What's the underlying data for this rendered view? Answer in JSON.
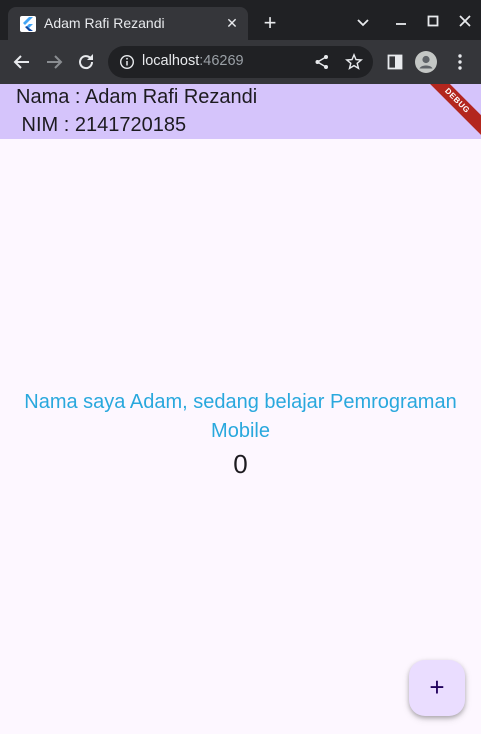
{
  "browser": {
    "tab": {
      "title": "Adam Rafi Rezandi",
      "close_glyph": "✕"
    },
    "new_tab_glyph": "+",
    "url": {
      "host": "localhost",
      "port": ":46269"
    },
    "icons": {
      "favicon": "flutter-logo-icon",
      "info": "info-icon",
      "share": "share-icon",
      "star": "bookmark-star-icon",
      "side_panel": "side-panel-icon",
      "profile": "profile-icon",
      "menu": "kebab-menu-icon",
      "back": "back-arrow-icon",
      "forward": "forward-arrow-icon",
      "reload": "reload-icon",
      "tab_search": "chevron-down-icon",
      "minimize": "minimize-icon",
      "maximize": "maximize-icon",
      "close": "close-icon"
    }
  },
  "app": {
    "appbar": {
      "line1": "Nama : Adam Rafi Rezandi",
      "line2": " NIM : 2141720185"
    },
    "debug_banner": "DEBUG",
    "body_text": "Nama saya Adam, sedang belajar Pemrograman Mobile",
    "counter": "0",
    "fab_label": "+",
    "colors": {
      "appbar": "#d5c4fb",
      "background": "#fdf7ff",
      "body_text": "#29a8dd",
      "fab": "#eaddff",
      "debug_banner": "#b3261e"
    }
  }
}
